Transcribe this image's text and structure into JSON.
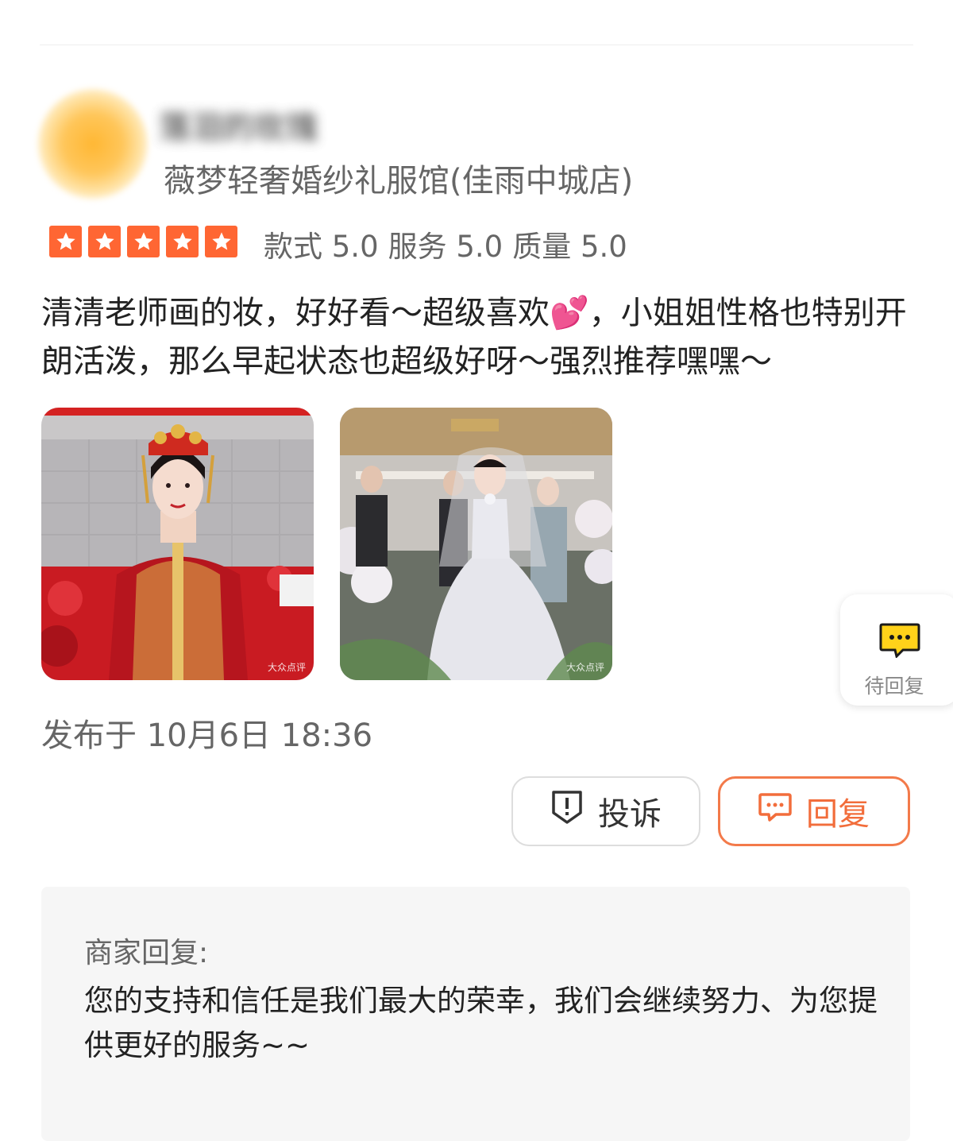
{
  "review": {
    "user": {
      "name": "落泪的玫瑰",
      "avatar_color": "#ffb733"
    },
    "shop_name": "薇梦轻奢婚纱礼服馆(佳雨中城店)",
    "rating": {
      "stars": 5,
      "max_stars": 5,
      "star_color": "#ff6633",
      "scores": [
        {
          "label": "款式",
          "value": "5.0"
        },
        {
          "label": "服务",
          "value": "5.0"
        },
        {
          "label": "质量",
          "value": "5.0"
        }
      ]
    },
    "text": "清清老师画的妆，好好看～超级喜欢💕，小姐姐性格也特别开朗活泼，那么早起状态也超级好呀～强烈推荐嘿嘿～",
    "photos": [
      {
        "watermark": "大众点评"
      },
      {
        "watermark": "大众点评"
      }
    ],
    "publish_time": "发布于 10月6日 18:36"
  },
  "pending_reply": {
    "label": "待回复",
    "icon": "chat-bubble-icon",
    "icon_color": "#ffd21a"
  },
  "actions": {
    "complain_label": "投诉",
    "complain_icon": "shield-alert-icon",
    "reply_label": "回复",
    "reply_icon": "chat-bubble-icon",
    "accent_color": "#f26d3b"
  },
  "merchant_reply": {
    "title": "商家回复:",
    "text": "您的支持和信任是我们最大的荣幸，我们会继续努力、为您提供更好的服务~~"
  }
}
